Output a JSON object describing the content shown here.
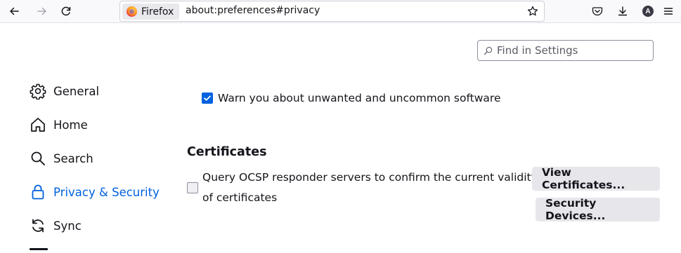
{
  "toolbar": {
    "identity_label": "Firefox",
    "url": "about:preferences#privacy",
    "icons": [
      "back-arrow-icon",
      "forward-arrow-icon",
      "reload-icon",
      "star-icon",
      "pocket-icon",
      "download-icon",
      "account-avatar",
      "menu-icon"
    ],
    "account_initial": "A"
  },
  "search": {
    "placeholder": "Find in Settings"
  },
  "sidebar": {
    "items": [
      {
        "label": "General",
        "icon": "gear-icon"
      },
      {
        "label": "Home",
        "icon": "home-icon"
      },
      {
        "label": "Search",
        "icon": "search-icon"
      },
      {
        "label": "Privacy & Security",
        "icon": "lock-icon",
        "selected": true
      },
      {
        "label": "Sync",
        "icon": "sync-icon"
      }
    ]
  },
  "main": {
    "warn_checkbox": {
      "label": "Warn you about unwanted and uncommon software",
      "checked": true
    },
    "certificates_heading": "Certificates",
    "ocsp_checkbox": {
      "label_line1": "Query OCSP responder servers to confirm the current validity",
      "label_line2": "of certificates",
      "checked": false
    },
    "view_certificates_label": "View Certificates...",
    "security_devices_label": "Security Devices..."
  },
  "colors": {
    "accent": "#0061e0",
    "toolbar_bg": "#f9f9fb",
    "button_bg": "#e6e6eb",
    "text": "#15141a"
  }
}
